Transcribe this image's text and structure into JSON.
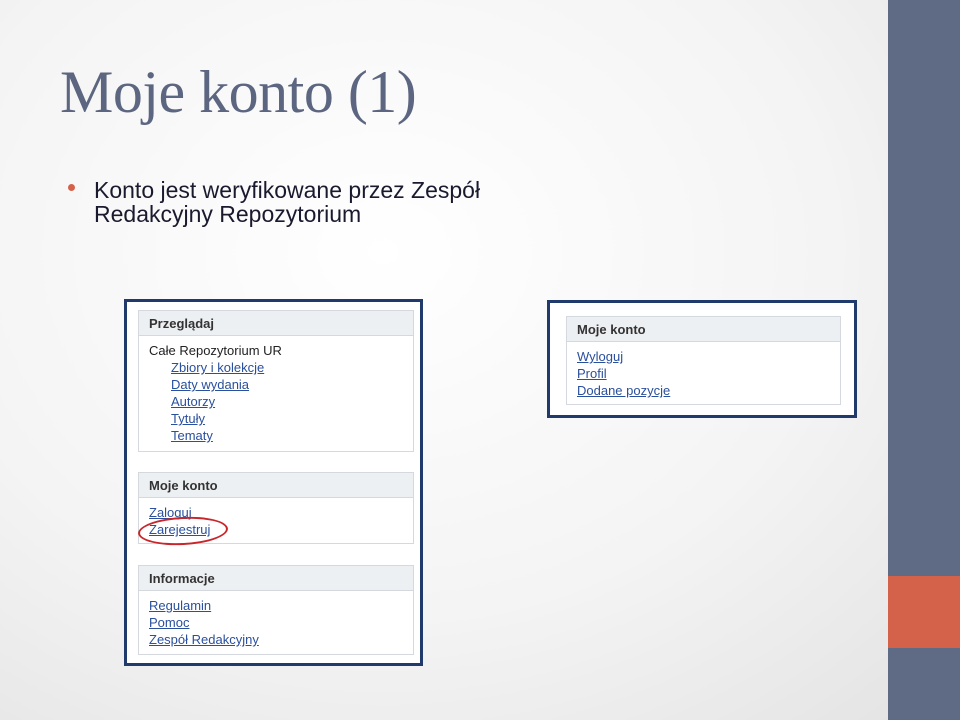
{
  "slide": {
    "title": "Moje konto (1)",
    "bullet": "Konto jest weryfikowane przez Zespół Redakcyjny Repozytorium"
  },
  "left_screenshot": {
    "browse": {
      "header": "Przeglądaj",
      "root": "Całe Repozytorium UR",
      "links": [
        "Zbiory i kolekcje",
        "Daty wydania",
        "Autorzy",
        "Tytuły",
        "Tematy"
      ]
    },
    "account": {
      "header": "Moje konto",
      "links": [
        "Zaloguj",
        "Zarejestruj"
      ]
    },
    "info": {
      "header": "Informacje",
      "links": [
        "Regulamin",
        "Pomoc",
        "Zespół Redakcyjny"
      ]
    }
  },
  "right_screenshot": {
    "account": {
      "header": "Moje konto",
      "links": [
        "Wyloguj",
        "Profil",
        "Dodane pozycje"
      ]
    }
  },
  "colors": {
    "accent": "#d4624a",
    "band": "#5f6a84",
    "title": "#5c6680",
    "frame": "#1f3a6b",
    "link": "#2a4f9c",
    "highlight_circle": "#c8262a"
  }
}
